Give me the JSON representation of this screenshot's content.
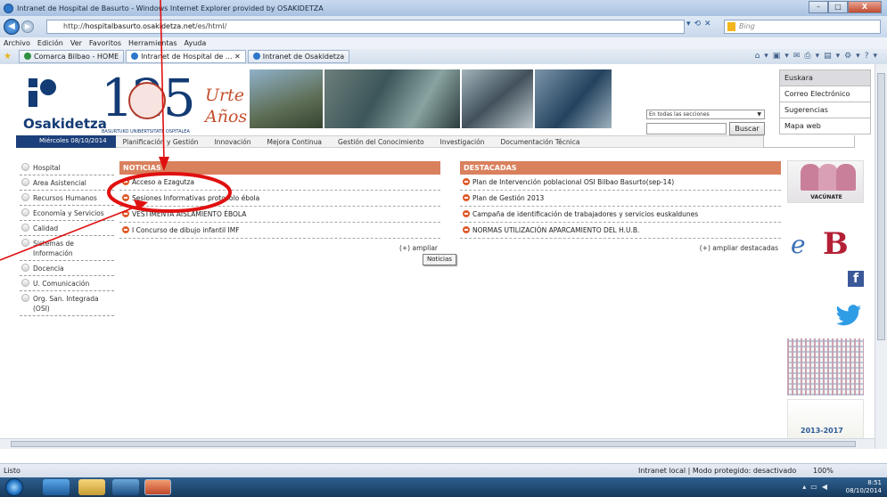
{
  "browser": {
    "window_title": "Intranet de Hospital de Basurto - Windows Internet Explorer provided by OSAKIDETZA",
    "address_prefix": "http://",
    "address_host": "hospitalbasurto.osakidetza.net",
    "address_path": "/es/html/",
    "search_placeholder": "Bing",
    "menu": [
      "Archivo",
      "Edición",
      "Ver",
      "Favoritos",
      "Herramientas",
      "Ayuda"
    ],
    "tabs": [
      {
        "label": "Comarca Bilbao - HOME"
      },
      {
        "label": "Intranet de Hospital de ..."
      },
      {
        "label": "Intranet de Osakidetza"
      }
    ],
    "window_buttons": {
      "minimize": "–",
      "maximize": "□",
      "close": "X"
    },
    "side_fragment": "ote"
  },
  "header": {
    "logo_text": "Osakidetza",
    "anniversary_number": "125",
    "anniversary_urte": "Urte",
    "anniversary_anos": "Años",
    "anniversary_sub": "BASURTUKO UNIBERTSITATE OSPITALEA",
    "section_select": "En todas las secciones",
    "search_button": "Buscar",
    "right_links": [
      "Euskara",
      "Correo Electrónico",
      "Sugerencias",
      "Mapa web"
    ]
  },
  "nav": {
    "date": "Miércoles 08/10/2014",
    "items": [
      "Planificación y Gestión",
      "Innovación",
      "Mejora Continua",
      "Gestión del Conocimiento",
      "Investigación",
      "Documentación Técnica"
    ]
  },
  "left_menu": [
    "Hospital",
    "Area Asistencial",
    "Recursos Humanos",
    "Economía y Servicios",
    "Calidad",
    "Sistemas de Información",
    "Docencia",
    "U. Comunicación",
    "Org. San. Integrada (OSI)"
  ],
  "noticias": {
    "heading": "NOTICIAS",
    "items": [
      "Acceso a Ezagutza",
      "Sesiones Informativas protocolo ébola",
      "VESTIMENTA AISLAMIENTO ÉBOLA",
      "I Concurso de dibujo infantil IMF"
    ],
    "more": "(+) ampliar",
    "tooltip": "Noticias"
  },
  "destacadas": {
    "heading": "DESTACADAS",
    "items": [
      "Plan de Intervención poblacional OSI Bilbao Basurto(sep-14)",
      "Plan de Gestión 2013",
      "Campaña de identificación de trabajadores y servicios euskaldunes",
      "NORMAS UTILIZACIÓN APARCAMIENTO DEL H.U.B."
    ],
    "more": "(+) ampliar destacadas"
  },
  "banners": {
    "vacunate": "VACÚNATE",
    "ebi_e": "e",
    "ebi_b": "B",
    "facebook": "f",
    "plan_years": "2013-2017"
  },
  "status": {
    "left": "Listo",
    "zone": "Intranet local | Modo protegido: desactivado",
    "zoom": "100%"
  },
  "taskbar": {
    "time": "8:51",
    "date": "08/10/2014"
  },
  "colors": {
    "brand_blue": "#1b3f7a",
    "section_header": "#d9805d",
    "annotation_red": "#e01010"
  }
}
